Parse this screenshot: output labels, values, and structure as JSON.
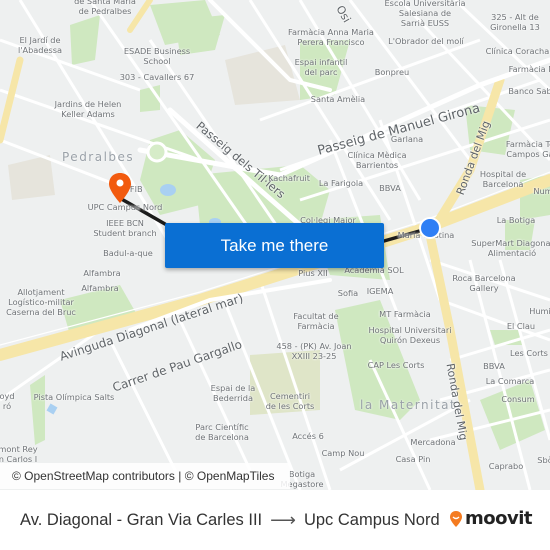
{
  "map": {
    "districts": [
      {
        "id": "pedralbes",
        "label": "Pedralbes"
      },
      {
        "id": "maternitat",
        "label": "la Maternitat"
      }
    ],
    "streets": [
      {
        "id": "passeig-manuel-girona",
        "label": "Passeig de Manuel Girona"
      },
      {
        "id": "passeig-tilers",
        "label": "Passeig dels Til·lers"
      },
      {
        "id": "avinguda-diagonal",
        "label": "Avinguda Diagonal (lateral mar)"
      },
      {
        "id": "carrer-pau-gargallo",
        "label": "Carrer de Pau Gargallo"
      },
      {
        "id": "ronda-mig-north",
        "label": "Ronda del Mig"
      },
      {
        "id": "ronda-mig-south",
        "label": "Ronda del Mig"
      },
      {
        "id": "osi",
        "label": "Osi"
      }
    ],
    "pois": [
      {
        "label": "de Santa Maria\nde Pedralbes"
      },
      {
        "label": "El Jardí de\nl'Abadessa"
      },
      {
        "label": "ESADE Business\nSchool"
      },
      {
        "label": "303 - Cavallers 67"
      },
      {
        "label": "Jardins de Helen\nKeller Adams"
      },
      {
        "label": "Escola Universitària\nSalesiana de\nSarrià EUSS"
      },
      {
        "label": "325 - Alt de\nGironella 13"
      },
      {
        "label": "Farmàcia Anna Maria\nPerera Francisco"
      },
      {
        "label": "L'Obrador del molí"
      },
      {
        "label": "Clínica Corachan"
      },
      {
        "label": "Espai infantil\ndel parc"
      },
      {
        "label": "Bonpreu"
      },
      {
        "label": "Farmàcia M"
      },
      {
        "label": "Banco Sab"
      },
      {
        "label": "Santa Amèlia"
      },
      {
        "label": "Garlana"
      },
      {
        "label": "Clínica Mèdica\nBarrientos"
      },
      {
        "label": "Farmàcia Te\nCampos Ga"
      },
      {
        "label": "Kachafruit"
      },
      {
        "label": "La Farigola"
      },
      {
        "label": "BBVA"
      },
      {
        "label": "Hospital de\nBarcelona"
      },
      {
        "label": "Num"
      },
      {
        "label": "Bar FIB"
      },
      {
        "label": "UPC Campus Nord"
      },
      {
        "label": "IEEE BCN\nStudent branch"
      },
      {
        "label": "Col·legi Major"
      },
      {
        "label": "La Botiga"
      },
      {
        "label": "Maria Cristina"
      },
      {
        "label": "SuperMart Diagonal\nAlimentació"
      },
      {
        "label": "Badul-a-que"
      },
      {
        "label": "Alfambra"
      },
      {
        "label": "Alfambra"
      },
      {
        "label": "Pius XII"
      },
      {
        "label": "Acadèmia SOL"
      },
      {
        "label": "Roca Barcelona\nGallery"
      },
      {
        "label": "Allotjament\nLogístico-militar\nCaserna del Bruc"
      },
      {
        "label": "Sofia"
      },
      {
        "label": "IGEMA"
      },
      {
        "label": "Humi"
      },
      {
        "label": "Facultat de\nFarmàcia"
      },
      {
        "label": "MT Farmàcia"
      },
      {
        "label": "Hospital Universitari\nQuirón Dexeus"
      },
      {
        "label": "El Clau"
      },
      {
        "label": "458 - (PK) Av. Joan\nXXIII 23-25"
      },
      {
        "label": "Les Corts"
      },
      {
        "label": "CAP Les Corts"
      },
      {
        "label": "BBVA"
      },
      {
        "label": "Pista Olímpica Salts"
      },
      {
        "label": "Espai de la\nBederrida"
      },
      {
        "label": "La Comarca"
      },
      {
        "label": "Consum"
      },
      {
        "label": "Parc Científic\nde Barcelona"
      },
      {
        "label": "Cementiri\nde les Corts"
      },
      {
        "label": "Accés 6"
      },
      {
        "label": "Mercadona"
      },
      {
        "label": "Camp Nou"
      },
      {
        "label": "Casa Pin"
      },
      {
        "label": "Caprabo"
      },
      {
        "label": "Sbò"
      },
      {
        "label": "Botiga\nMegastore"
      },
      {
        "label": "mont Rey\nn Carlos I"
      },
      {
        "label": "oyd\nró"
      }
    ],
    "origin": {
      "label": "Av. Diagonal - Gran Via Carles III",
      "marker_color": "#2f7ff5"
    },
    "destination": {
      "label": "Upc Campus Nord",
      "marker_color": "#f25a0e"
    },
    "route_color": "#1b1b1b",
    "cta": {
      "label": "Take me there",
      "color": "#0a6fd3"
    },
    "attribution": "© OpenStreetMap contributors | © OpenMapTiles"
  },
  "footer": {
    "origin": "Av. Diagonal - Gran Via Carles III",
    "arrow": "⟶",
    "destination": "Upc Campus Nord",
    "brand": "moovit",
    "brand_color": "#f47b20"
  }
}
